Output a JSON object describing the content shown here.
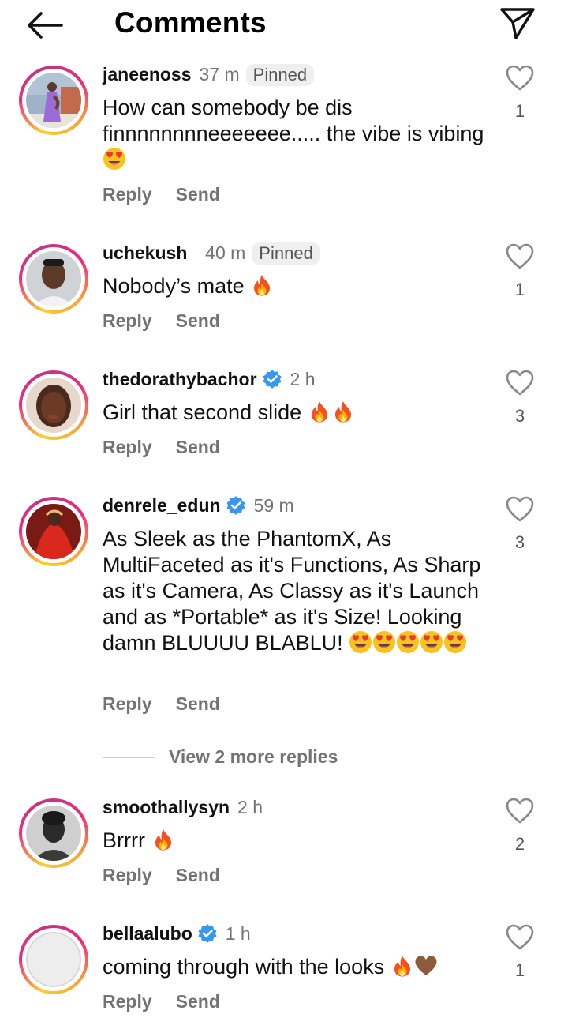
{
  "header": {
    "title": "Comments"
  },
  "actions": {
    "reply": "Reply",
    "send": "Send"
  },
  "comments": [
    {
      "username": "janeenoss",
      "time": "37 m",
      "badge": "Pinned",
      "text": "How can somebody be dis finnnnnnnneeeeeee..... the vibe is vibing",
      "likes": "1"
    },
    {
      "username": "uchekush_",
      "time": "40 m",
      "badge": "Pinned",
      "text": "Nobody’s mate",
      "likes": "1"
    },
    {
      "username": "thedorathybachor",
      "time": "2 h",
      "text": "Girl that second slide",
      "likes": "3"
    },
    {
      "username": "denrele_edun",
      "time": "59 m",
      "text": "As Sleek as the PhantomX, As MultiFaceted as it's Functions, As Sharp as it's Camera, As Classy as it's Launch and as *Portable* as it's Size! Looking damn BLUUUU BLABLU!",
      "likes": "3"
    },
    {
      "username": "smoothallysyn",
      "time": "2 h",
      "text": "Brrrr",
      "likes": "2"
    },
    {
      "username": "bellaalubo",
      "time": "1 h",
      "text": "coming through with the looks",
      "likes": "1"
    }
  ],
  "view_more": "View 2 more replies",
  "icons": {
    "back": "arrow-left-icon",
    "send": "paper-plane-icon",
    "like": "heart-outline-icon",
    "verified": "verified-badge-icon",
    "fire": "fire-emoji",
    "heart_eyes": "heart-eyes-emoji",
    "brown_heart": "brown-heart-emoji"
  },
  "colors": {
    "verified": "#3897f0",
    "secondary_text": "#737373",
    "pinned_bg": "#efefef"
  }
}
